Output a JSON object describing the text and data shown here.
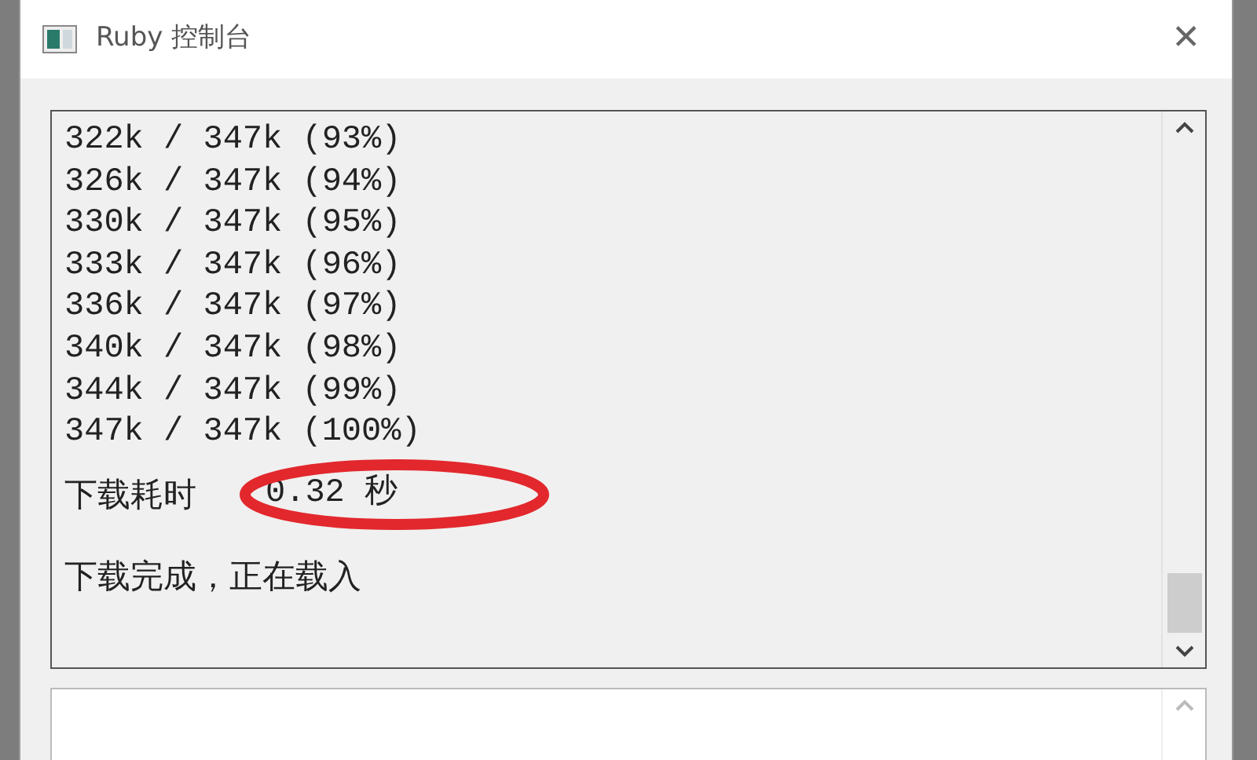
{
  "window": {
    "title": "Ruby 控制台",
    "close": "✕"
  },
  "console": {
    "lines": [
      "322k / 347k (93%)",
      "326k / 347k (94%)",
      "330k / 347k (95%)",
      "333k / 347k (96%)",
      "336k / 347k (97%)",
      "340k / 347k (98%)",
      "344k / 347k (99%)",
      "347k / 347k (100%)"
    ],
    "timing": {
      "label": "下载耗时",
      "value": "0.32 秒",
      "highlighted": true
    },
    "status_message": "下载完成，正在载入"
  }
}
